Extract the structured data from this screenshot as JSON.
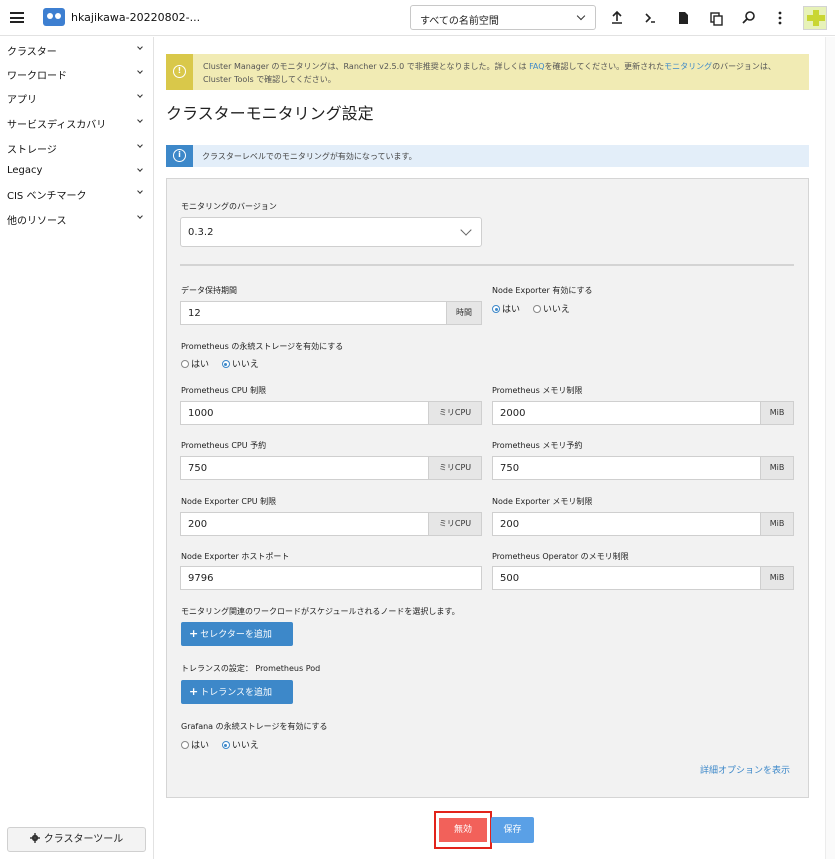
{
  "header": {
    "cluster_name": "hkajikawa-20220802-...",
    "namespace_select": "すべての名前空間",
    "icons": [
      "upload-icon",
      "terminal-icon",
      "file-icon",
      "copy-icon",
      "search-icon",
      "more-vert-icon"
    ]
  },
  "sidebar": {
    "items": [
      {
        "label": "クラスター"
      },
      {
        "label": "ワークロード"
      },
      {
        "label": "アプリ"
      },
      {
        "label": "サービスディスカバリ"
      },
      {
        "label": "ストレージ"
      },
      {
        "label": "Legacy"
      },
      {
        "label": "CIS ベンチマーク"
      },
      {
        "label": "他のリソース"
      }
    ],
    "cluster_tools": "クラスターツール"
  },
  "warning_banner": {
    "text_before_faq": "Cluster Manager のモニタリングは、Rancher v2.5.0 で非推奨となりました。詳しくは",
    "faq_link": "FAQ",
    "text_mid": "を確認してください。更新された",
    "monitoring_link": "モニタリング",
    "text_after": "のバージョンは、Cluster Tools で確認してください。"
  },
  "page_title": "クラスターモニタリング設定",
  "info_banner": "クラスターレベルでのモニタリングが有効になっています。",
  "form": {
    "version_label": "モニタリングのバージョン",
    "version_value": "0.3.2",
    "retention_label": "データ保持期間",
    "retention_value": "12",
    "retention_unit": "時間",
    "node_exporter_enable_label": "Node Exporter 有効にする",
    "yes": "はい",
    "no": "いいえ",
    "prom_storage_label": "Prometheus の永続ストレージを有効にする",
    "prom_cpu_limit_label": "Prometheus CPU 制限",
    "prom_cpu_limit_value": "1000",
    "prom_mem_limit_label": "Prometheus メモリ制限",
    "prom_mem_limit_value": "2000",
    "prom_cpu_req_label": "Prometheus CPU 予約",
    "prom_cpu_req_value": "750",
    "prom_mem_req_label": "Prometheus メモリ予約",
    "prom_mem_req_value": "750",
    "ne_cpu_limit_label": "Node Exporter CPU 制限",
    "ne_cpu_limit_value": "200",
    "ne_mem_limit_label": "Node Exporter メモリ制限",
    "ne_mem_limit_value": "200",
    "ne_host_port_label": "Node Exporter ホストポート",
    "ne_host_port_value": "9796",
    "op_mem_limit_label": "Prometheus Operator のメモリ制限",
    "op_mem_limit_value": "500",
    "unit_milli_cpu": "ミリCPU",
    "unit_mib": "MiB",
    "node_select_label": "モニタリング関連のワークロードがスケジュールされるノードを選択します。",
    "add_selector": "セレクターを追加",
    "toleration_label": "トレランスの設定： Prometheus Pod",
    "add_toleration": "トレランスを追加",
    "grafana_storage_label": "Grafana の永続ストレージを有効にする",
    "show_advanced": "詳細オプションを表示"
  },
  "footer": {
    "disable": "無効",
    "save": "保存"
  }
}
